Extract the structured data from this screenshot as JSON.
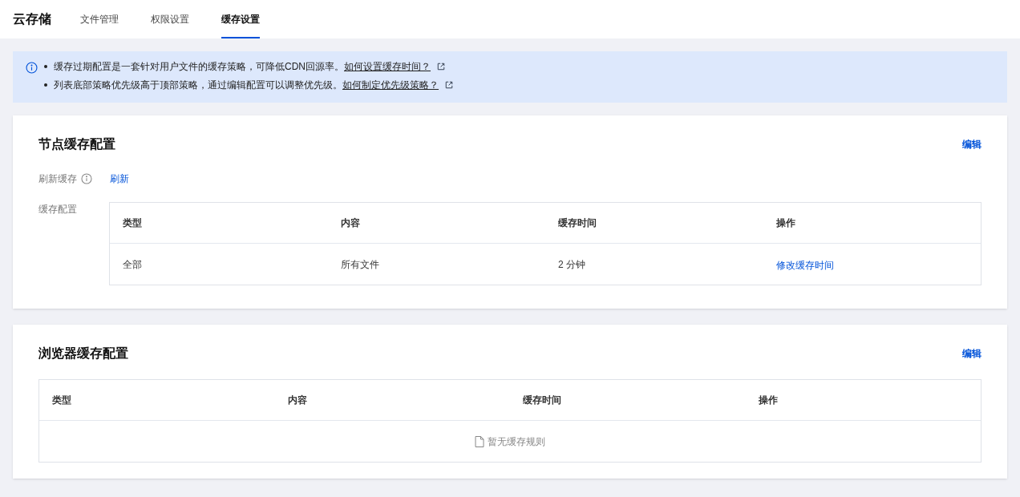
{
  "header": {
    "title": "云存储",
    "tabs": [
      {
        "label": "文件管理",
        "selected": false
      },
      {
        "label": "权限设置",
        "selected": false
      },
      {
        "label": "缓存设置",
        "selected": true
      }
    ]
  },
  "notice": {
    "items": [
      {
        "text": "缓存过期配置是一套针对用户文件的缓存策略，可降低CDN回源率。",
        "link": "如何设置缓存时间？"
      },
      {
        "text": "列表底部策略优先级高于顶部策略，通过编辑配置可以调整优先级。",
        "link": "如何制定优先级策略？"
      }
    ]
  },
  "node_cache": {
    "title": "节点缓存配置",
    "edit": "编辑",
    "refresh_label": "刷新缓存",
    "refresh_action": "刷新",
    "config_label": "缓存配置",
    "table": {
      "columns": [
        "类型",
        "内容",
        "缓存时间",
        "操作"
      ],
      "rows": [
        {
          "cells": [
            "全部",
            "所有文件",
            "2 分钟"
          ],
          "action": "修改缓存时间"
        }
      ]
    }
  },
  "browser_cache": {
    "title": "浏览器缓存配置",
    "edit": "编辑",
    "table": {
      "columns": [
        "类型",
        "内容",
        "缓存时间",
        "操作"
      ],
      "empty": "暂无缓存规则"
    }
  }
}
